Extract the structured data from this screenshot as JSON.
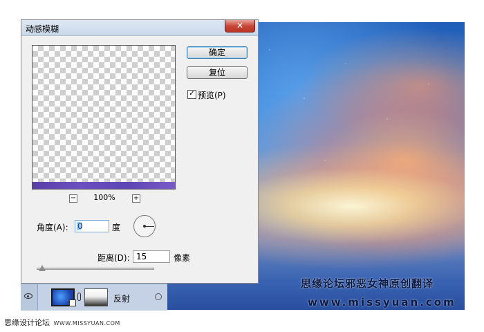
{
  "dialog": {
    "title": "动感模糊",
    "close_label": "✕",
    "ok_label": "确定",
    "reset_label": "复位",
    "preview_label": "预览(P)",
    "preview_checked": true,
    "zoom_out_label": "−",
    "zoom_in_label": "+",
    "zoom_level": "100%",
    "angle_label": "角度(A):",
    "angle_value": "0",
    "angle_unit": "度",
    "distance_label": "距离(D):",
    "distance_value": "15",
    "distance_unit": "像素",
    "distance_slider_fraction": 0.015
  },
  "layer": {
    "name": "反射",
    "visible": true
  },
  "watermark": {
    "forum_title": "思缘论坛邪恶女神原创翻译",
    "url": "www.missyuan.com"
  },
  "footer": {
    "site_name": "思缘设计论坛",
    "url": "WWW.MISSYUAN.COM"
  },
  "colors": {
    "accent_blue": "#3c7fb1",
    "close_red": "#c8483a",
    "preview_strip": "#6c4fc0"
  }
}
